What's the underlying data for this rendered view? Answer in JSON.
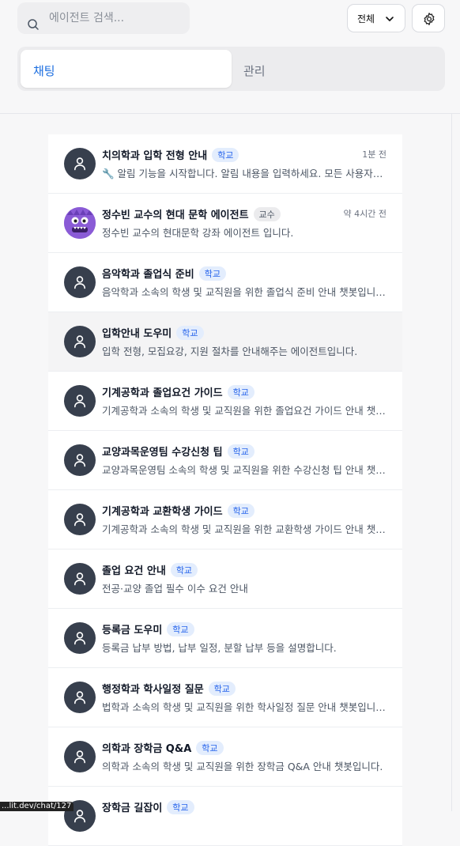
{
  "search": {
    "placeholder": "에이전트 검색..."
  },
  "filter": {
    "selected": "전체"
  },
  "tabs": [
    {
      "label": "채팅"
    },
    {
      "label": "관리"
    }
  ],
  "colors": {
    "accent": "#1d6fe0",
    "avatar": "#373f4d",
    "badge_bg": "#e3edfd",
    "badge_text": "#2563eb"
  },
  "agents": [
    {
      "title": "치의학과 입학 전형 안내",
      "badge": "학교",
      "time": "1분 전",
      "desc": "🔧 알림 기능을 시작합니다. 알림 내용을 입력하세요. 모든 사용자에게 알림이 전송됩니다."
    },
    {
      "title": "정수빈 교수의 현대 문학 에이전트",
      "badge": "교수",
      "time": "약 4시간 전",
      "desc": "정수빈 교수의 현대문학 강좌 에이전트 입니다."
    },
    {
      "title": "음악학과 졸업식 준비",
      "badge": "학교",
      "desc": "음악학과 소속의 학생 및 교직원을 위한 졸업식 준비 안내 챗봇입니다."
    },
    {
      "title": "입학안내 도우미",
      "badge": "학교",
      "desc": "입학 전형, 모집요강, 지원 절차를 안내해주는 에이전트입니다."
    },
    {
      "title": "기계공학과 졸업요건 가이드",
      "badge": "학교",
      "desc": "기계공학과 소속의 학생 및 교직원을 위한 졸업요건 가이드 안내 챗봇입니다."
    },
    {
      "title": "교양과목운영팀 수강신청 팁",
      "badge": "학교",
      "desc": "교양과목운영팀 소속의 학생 및 교직원을 위한 수강신청 팁 안내 챗봇입니다."
    },
    {
      "title": "기계공학과 교환학생 가이드",
      "badge": "학교",
      "desc": "기계공학과 소속의 학생 및 교직원을 위한 교환학생 가이드 안내 챗봇입니다."
    },
    {
      "title": "졸업 요건 안내",
      "badge": "학교",
      "desc": "전공·교양 졸업 필수 이수 요건 안내"
    },
    {
      "title": "등록금 도우미",
      "badge": "학교",
      "desc": "등록금 납부 방법, 납부 일정, 분할 납부 등을 설명합니다."
    },
    {
      "title": "행정학과 학사일정 질문",
      "badge": "학교",
      "desc": "법학과 소속의 학생 및 교직원을 위한 학사일정 질문 안내 챗봇입니다."
    },
    {
      "title": "의학과 장학금 Q&A",
      "badge": "학교",
      "desc": "의학과 소속의 학생 및 교직원을 위한 장학금 Q&A 안내 챗봇입니다."
    },
    {
      "title": "장학금 길잡이",
      "badge": "학교",
      "desc": ""
    }
  ],
  "status_url": "...lit.dev/chat/127"
}
